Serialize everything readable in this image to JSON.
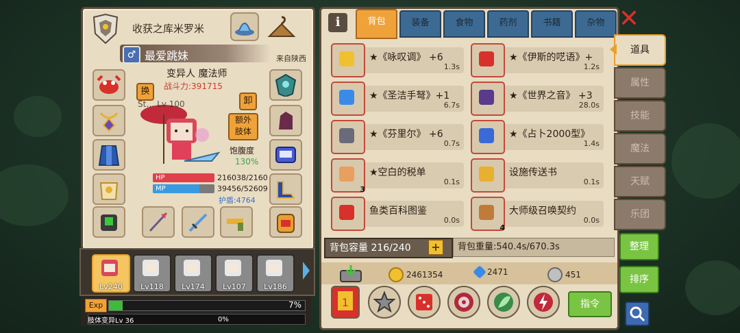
{
  "left": {
    "title": "收获之库米罗米",
    "character": {
      "name": "最爱跳妹",
      "origin": "来自陕西",
      "class": "变异人 魔法师",
      "power": "战斗力:391715",
      "level_overlay": "St… Lv 100",
      "swap_label": "换",
      "unequip_label": "卸",
      "extra_limb_label": "额外\n肢体",
      "satiety_label": "饱腹度",
      "satiety_value": "130%",
      "hp_label": "HP",
      "hp_value": "216038/2160",
      "hp_fraction": 1.0,
      "mp_label": "MP",
      "mp_value": "39456/52609",
      "mp_fraction": 0.75,
      "shield": "护盾:4764"
    },
    "party": [
      {
        "level": "Lv240",
        "active": true
      },
      {
        "level": "Lv118",
        "active": false
      },
      {
        "level": "Lv174",
        "active": false
      },
      {
        "level": "Lv107",
        "active": false
      },
      {
        "level": "Lv186",
        "active": false
      }
    ],
    "exp": {
      "tag": "Exp",
      "percent_label": "7%",
      "fraction": 0.07,
      "sub_label": "肢体变异Lv 36",
      "sub_percent": "0%"
    }
  },
  "right": {
    "tabs": [
      "背包",
      "装备",
      "食物",
      "药剂",
      "书籍",
      "杂物"
    ],
    "active_tab": 0,
    "items": [
      {
        "name": "★《咏叹调》 +6",
        "time": "1.3s",
        "badge": ""
      },
      {
        "name": "★《伊斯的呓语》+",
        "time": "1.2s",
        "badge": ""
      },
      {
        "name": "★《圣洁手弩》+1",
        "time": "6.7s",
        "badge": ""
      },
      {
        "name": "★《世界之音》 +3",
        "time": "28.0s",
        "badge": ""
      },
      {
        "name": "★《芬里尔》 +6",
        "time": "0.7s",
        "badge": ""
      },
      {
        "name": "★《占卜2000型》",
        "time": "1.4s",
        "badge": ""
      },
      {
        "name": "★空白的税单",
        "time": "0.1s",
        "badge": "3"
      },
      {
        "name": "设施传送书",
        "time": "0.1s",
        "badge": ""
      },
      {
        "name": "鱼类百科图鉴",
        "time": "0.0s",
        "badge": ""
      },
      {
        "name": "大师级召唤契约",
        "time": "0.0s",
        "badge": "4"
      }
    ],
    "capacity": "背包容量 216/240",
    "weight": "背包重量:540.4s/670.3s",
    "currency": {
      "gold": "2461354",
      "diamond": "2471",
      "silver": "451"
    },
    "order_label": "指令"
  },
  "side": {
    "tabs": [
      "道具",
      "属性",
      "技能",
      "魔法",
      "天赋",
      "乐团"
    ],
    "active": 0,
    "sort_label": "整理",
    "order_label": "排序"
  }
}
